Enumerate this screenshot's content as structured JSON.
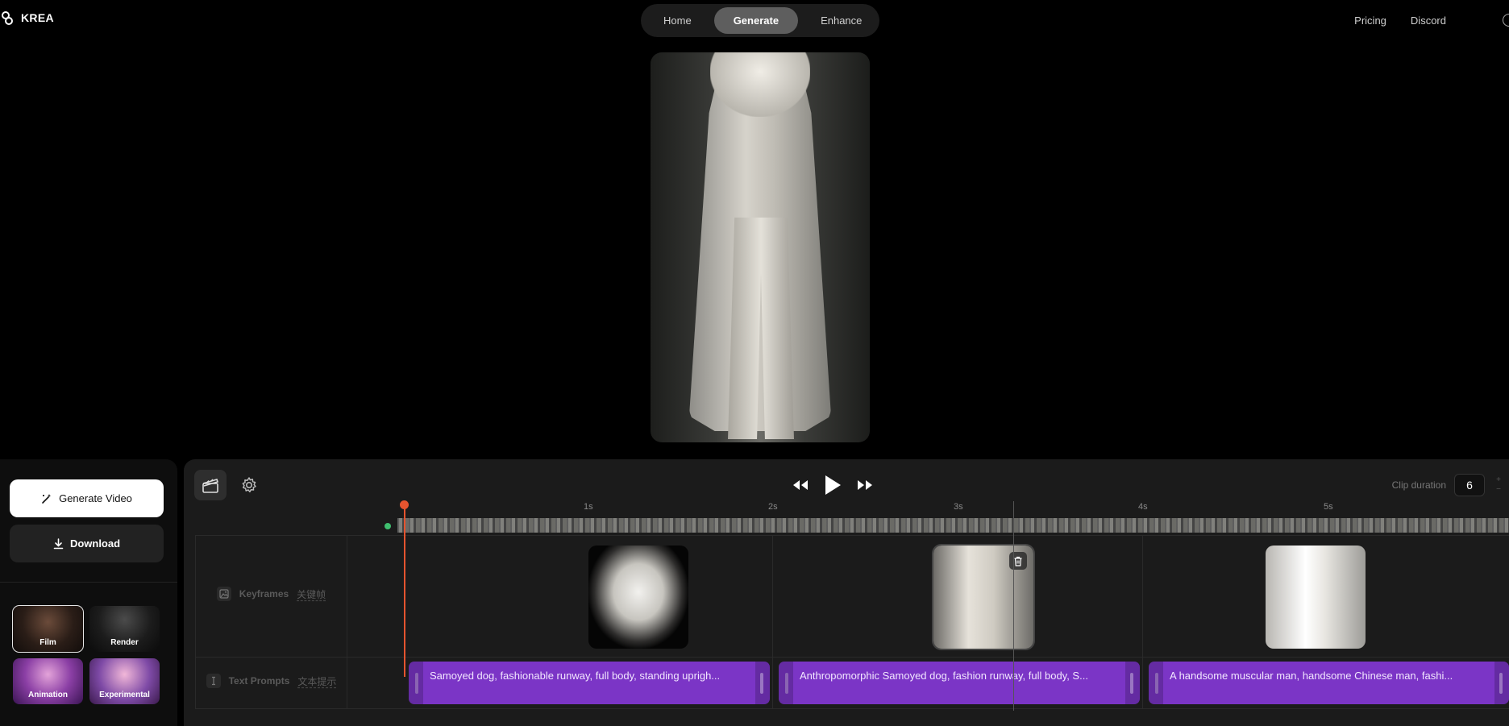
{
  "header": {
    "brand": "KREA",
    "nav": [
      {
        "label": "Home",
        "active": false
      },
      {
        "label": "Generate",
        "active": true
      },
      {
        "label": "Enhance",
        "active": false
      }
    ],
    "links": [
      "Pricing",
      "Discord"
    ]
  },
  "sidebar": {
    "generate_label": "Generate Video",
    "download_label": "Download",
    "styles": [
      {
        "label": "Film",
        "selected": true
      },
      {
        "label": "Render",
        "selected": false
      },
      {
        "label": "Animation",
        "selected": false
      },
      {
        "label": "Experimental",
        "selected": false
      }
    ]
  },
  "timeline": {
    "clip_duration_label": "Clip duration",
    "clip_duration_value": "6",
    "ruler": [
      "1s",
      "2s",
      "3s",
      "4s",
      "5s"
    ],
    "tracks": {
      "keyframes": {
        "label": "Keyframes",
        "sub": "关键帧"
      },
      "prompts": {
        "label": "Text Prompts",
        "sub": "文本提示"
      }
    },
    "prompts": [
      "Samoyed dog, fashionable runway, full body, standing uprigh...",
      "Anthropomorphic Samoyed dog, fashion runway, full body, S...",
      "A handsome muscular man, handsome Chinese man, fashi..."
    ]
  },
  "colors": {
    "accent_purple": "#7b35c6",
    "playhead": "#e5542f",
    "marker_green": "#3fbf6f"
  }
}
